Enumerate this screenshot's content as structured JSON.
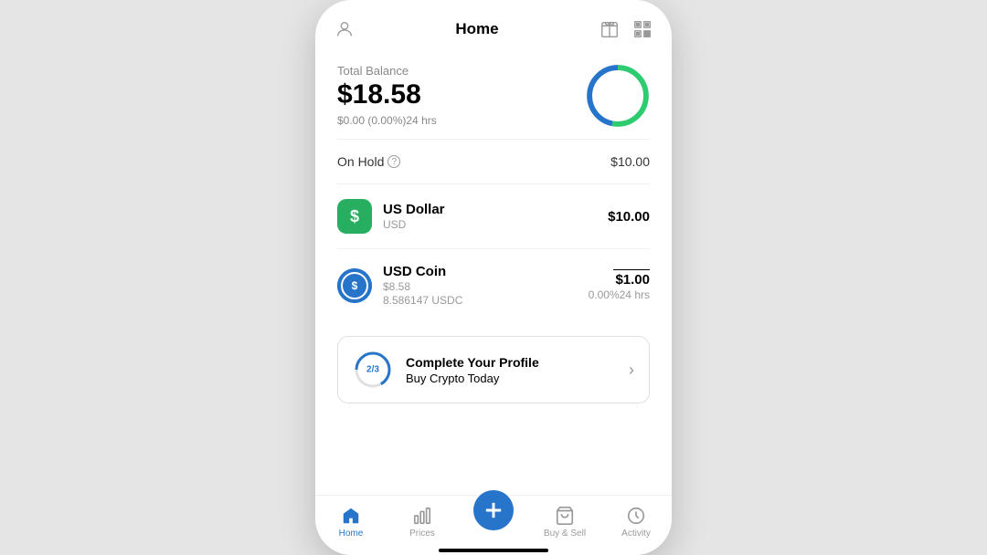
{
  "header": {
    "title": "Home",
    "gift_icon": "gift",
    "qr_icon": "qr-code"
  },
  "balance": {
    "label": "Total Balance",
    "amount": "$18.58",
    "change": "$0.00 (0.00%)24 hrs"
  },
  "donut": {
    "green_pct": 53,
    "blue_pct": 47
  },
  "on_hold": {
    "label": "On Hold",
    "value": "$10.00"
  },
  "assets": [
    {
      "name": "US Dollar",
      "ticker": "USD",
      "icon_type": "usd",
      "icon_label": "$",
      "value": "$10.00",
      "change": null,
      "sub_amount": null
    },
    {
      "name": "USD Coin",
      "ticker": null,
      "icon_type": "usdc",
      "icon_label": "$",
      "amount": "$8.58",
      "sub_amount": "8.586147 USDC",
      "value": "$1.00",
      "change": "0.00%24 hrs"
    }
  ],
  "profile_card": {
    "progress_label": "2/3",
    "title": "Complete Your Profile",
    "subtitle": "Buy Crypto Today"
  },
  "bottom_nav": [
    {
      "id": "home",
      "label": "Home",
      "active": true,
      "icon": "home"
    },
    {
      "id": "prices",
      "label": "Prices",
      "active": false,
      "icon": "bar-chart"
    },
    {
      "id": "add",
      "label": "",
      "active": false,
      "icon": "plus"
    },
    {
      "id": "buy-sell",
      "label": "Buy & Sell",
      "active": false,
      "icon": "cart"
    },
    {
      "id": "activity",
      "label": "Activity",
      "active": false,
      "icon": "clock"
    }
  ]
}
